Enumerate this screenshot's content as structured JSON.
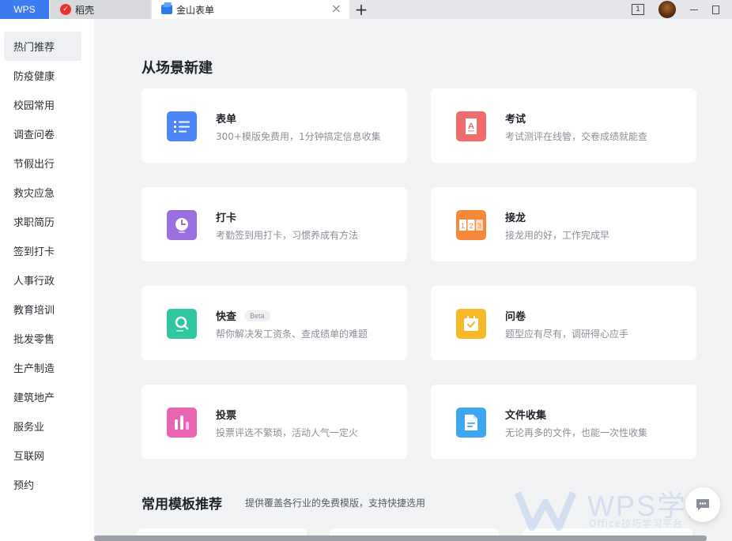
{
  "tabbar": {
    "app_tab": "WPS",
    "tabs": [
      {
        "label": "稻壳"
      },
      {
        "label": "金山表单"
      }
    ],
    "close_glyph": "×",
    "add_glyph": "+",
    "screen_badge": "1"
  },
  "sidebar": {
    "items": [
      {
        "label": "热门推荐",
        "active": true
      },
      {
        "label": "防疫健康"
      },
      {
        "label": "校园常用"
      },
      {
        "label": "调查问卷"
      },
      {
        "label": "节假出行"
      },
      {
        "label": "救灾应急"
      },
      {
        "label": "求职简历"
      },
      {
        "label": "签到打卡"
      },
      {
        "label": "人事行政"
      },
      {
        "label": "教育培训"
      },
      {
        "label": "批发零售"
      },
      {
        "label": "生产制造"
      },
      {
        "label": "建筑地产"
      },
      {
        "label": "服务业"
      },
      {
        "label": "互联网"
      },
      {
        "label": "预约"
      }
    ]
  },
  "main": {
    "section_title": "从场景新建",
    "cards": [
      {
        "title": "表单",
        "desc": "300+模版免费用，1分钟搞定信息收集",
        "icon": "form-list-icon",
        "color": "#4a86f7"
      },
      {
        "title": "考试",
        "desc": "考试测评在线管，交卷成绩就能查",
        "icon": "exam-paper-icon",
        "color": "#f26b6b"
      },
      {
        "title": "打卡",
        "desc": "考勤签到用打卡，习惯养成有方法",
        "icon": "clock-checkin-icon",
        "color": "#9b6fe0"
      },
      {
        "title": "接龙",
        "desc": "接龙用的好，工作完成早",
        "icon": "number-sequence-icon",
        "color": "#f5893a"
      },
      {
        "title": "快查",
        "badge": "Beta",
        "desc": "帮你解决发工资条、查成绩单的难题",
        "icon": "quick-search-icon",
        "color": "#2fc6a0"
      },
      {
        "title": "问卷",
        "desc": "题型应有尽有，调研得心应手",
        "icon": "survey-calendar-icon",
        "color": "#f7b928"
      },
      {
        "title": "投票",
        "desc": "投票评选不繁琐，活动人气一定火",
        "icon": "vote-bars-icon",
        "color": "#e964b3"
      },
      {
        "title": "文件收集",
        "desc": "无论再多的文件，也能一次性收集",
        "icon": "file-collect-icon",
        "color": "#3ea7f2"
      }
    ],
    "recommend_title": "常用模板推荐",
    "recommend_subtitle": "提供覆盖各行业的免费模版，支持快捷选用"
  },
  "watermark": {
    "brand": "WPS学堂",
    "slogan": "Office技巧学习平台"
  }
}
